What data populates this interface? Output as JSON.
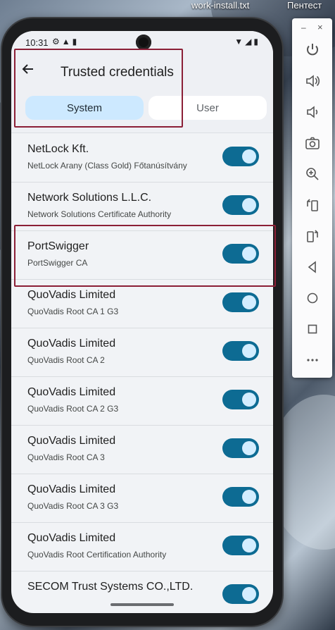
{
  "desktop": {
    "file_label": "work-install.txt",
    "right_label": "Пентест"
  },
  "status_bar": {
    "time": "10:31",
    "left_icons": [
      "settings-icon",
      "warning-icon",
      "sim-icon"
    ],
    "right_icons": [
      "wifi-icon",
      "cellular-icon",
      "battery-icon"
    ]
  },
  "app": {
    "title": "Trusted credentials",
    "tabs": [
      {
        "label": "System",
        "selected": true
      },
      {
        "label": "User",
        "selected": false
      }
    ]
  },
  "credentials": [
    {
      "title": "NetLock Kft.",
      "subtitle": "NetLock Arany (Class Gold) Főtanúsítvány",
      "enabled": true
    },
    {
      "title": "Network Solutions L.L.C.",
      "subtitle": "Network Solutions Certificate Authority",
      "enabled": true
    },
    {
      "title": "PortSwigger",
      "subtitle": "PortSwigger CA",
      "enabled": true
    },
    {
      "title": "QuoVadis Limited",
      "subtitle": "QuoVadis Root CA 1 G3",
      "enabled": true
    },
    {
      "title": "QuoVadis Limited",
      "subtitle": "QuoVadis Root CA 2",
      "enabled": true
    },
    {
      "title": "QuoVadis Limited",
      "subtitle": "QuoVadis Root CA 2 G3",
      "enabled": true
    },
    {
      "title": "QuoVadis Limited",
      "subtitle": "QuoVadis Root CA 3",
      "enabled": true
    },
    {
      "title": "QuoVadis Limited",
      "subtitle": "QuoVadis Root CA 3 G3",
      "enabled": true
    },
    {
      "title": "QuoVadis Limited",
      "subtitle": "QuoVadis Root Certification Authority",
      "enabled": true
    },
    {
      "title": "SECOM Trust Systems CO.,LTD.",
      "subtitle": "",
      "enabled": true
    }
  ],
  "side_panel": {
    "window_controls": {
      "minimize": "–",
      "close": "×"
    },
    "buttons": [
      "power-icon",
      "volume-up-icon",
      "volume-down-icon",
      "camera-icon",
      "zoom-icon",
      "rotate-left-icon",
      "rotate-right-icon",
      "back-icon",
      "home-icon",
      "overview-icon",
      "more-icon"
    ]
  },
  "colors": {
    "accent_toggle": "#0d6b93",
    "selected_tab": "#cde9ff",
    "highlight_box": "#8b1f36"
  }
}
